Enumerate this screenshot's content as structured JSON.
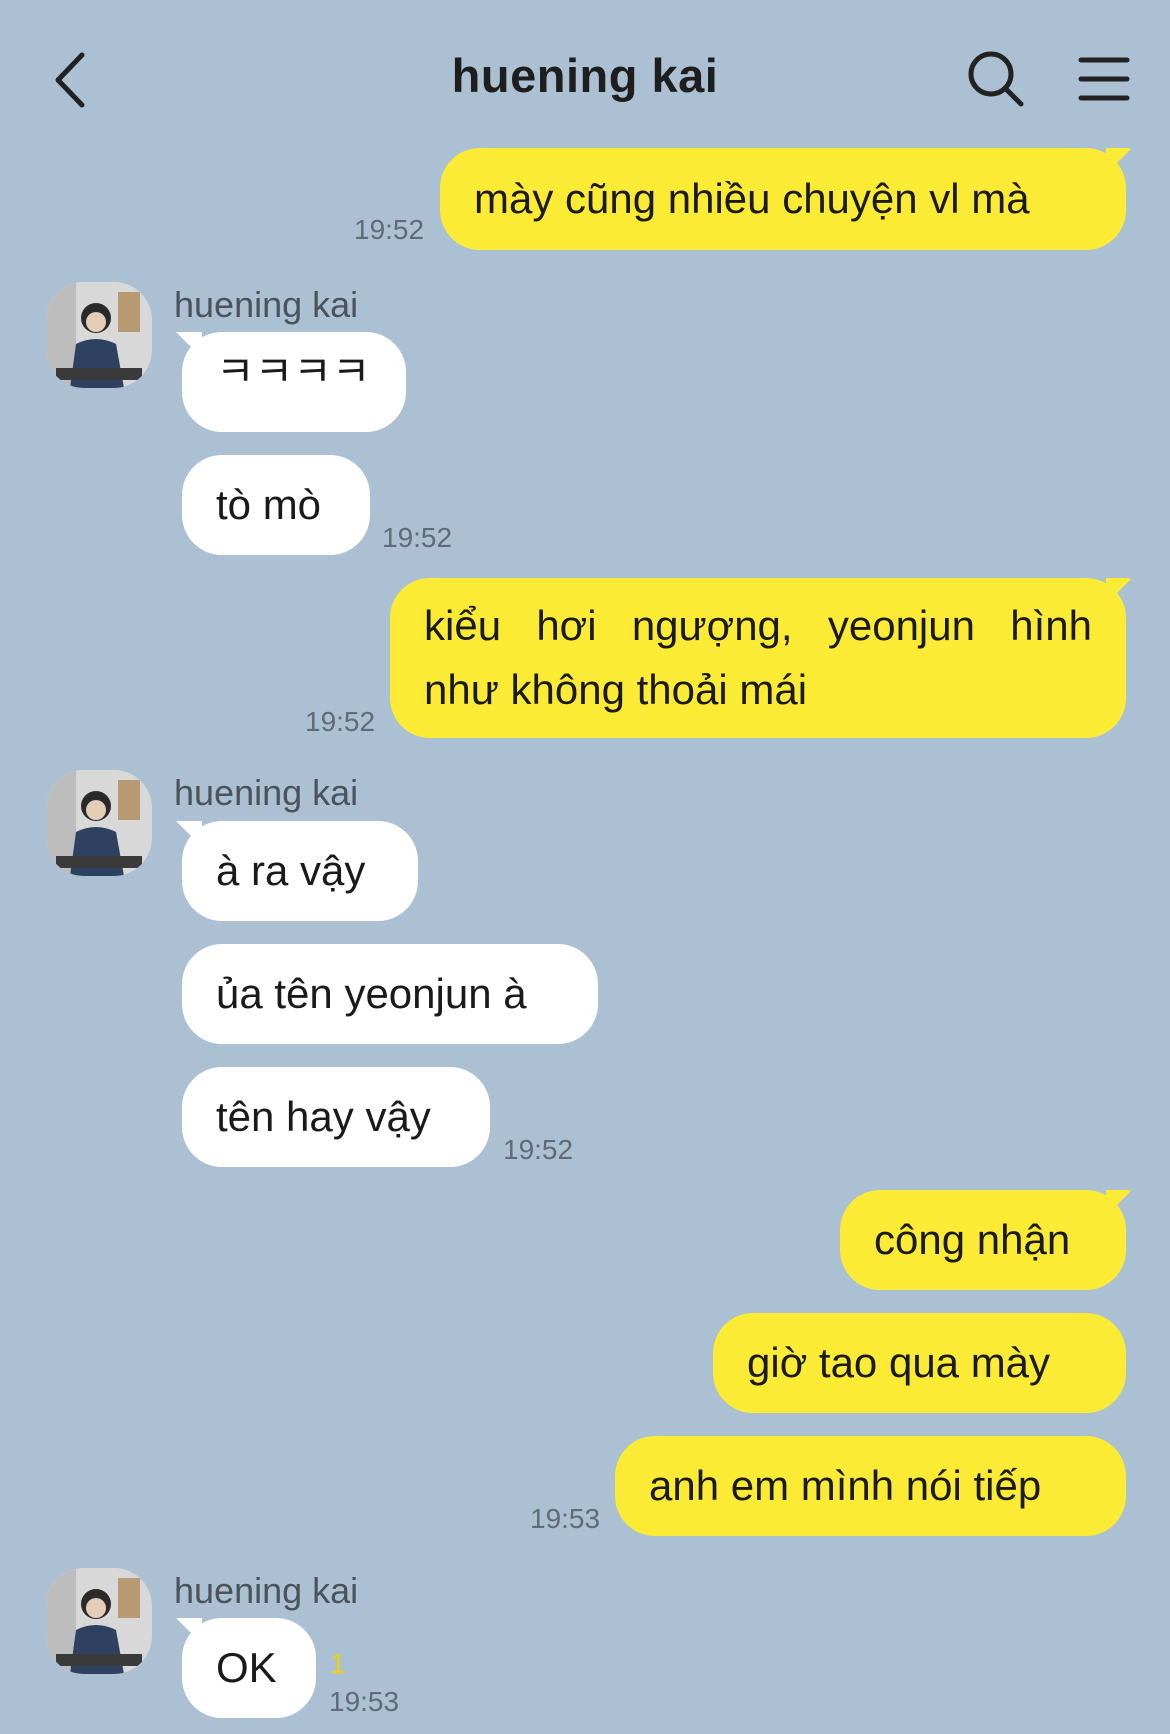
{
  "header": {
    "title": "huening kai",
    "back_icon": "chevron-left-icon",
    "search_icon": "search-icon",
    "menu_icon": "hamburger-menu-icon"
  },
  "colors": {
    "background": "#abc1d3",
    "my_bubble": "#fbeb35",
    "their_bubble": "#ffffff",
    "unread_count": "#f3d000"
  },
  "messages": [
    {
      "from": "me",
      "text": "mày cũng nhiều chuyện vl mà",
      "time": "19:52"
    },
    {
      "from": "them",
      "sender": "huening kai",
      "text": "ㅋㅋㅋㅋ"
    },
    {
      "from": "them",
      "text": "tò mò",
      "time": "19:52"
    },
    {
      "from": "me",
      "text_line1": "kiểu hơi ngượng, yeonjun hình",
      "text_line2": "như không thoải mái",
      "time": "19:52"
    },
    {
      "from": "them",
      "sender": "huening kai",
      "text": "à ra vậy"
    },
    {
      "from": "them",
      "text": "ủa tên yeonjun à"
    },
    {
      "from": "them",
      "text": "tên hay vậy",
      "time": "19:52"
    },
    {
      "from": "me",
      "text": "công nhận"
    },
    {
      "from": "me",
      "text": "giờ tao qua mày"
    },
    {
      "from": "me",
      "text": "anh em mình nói tiếp",
      "time": "19:53"
    },
    {
      "from": "them",
      "sender": "huening kai",
      "text": "OK",
      "unread": "1",
      "time": "19:53"
    }
  ]
}
